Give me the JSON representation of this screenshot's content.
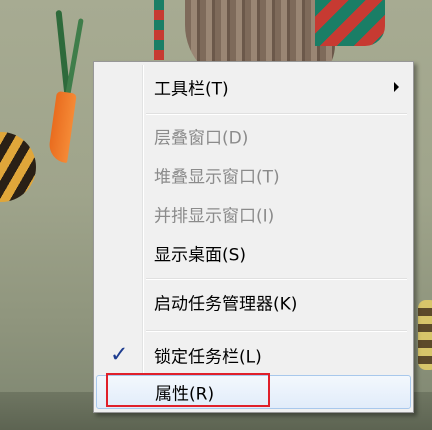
{
  "context_menu": {
    "items": [
      {
        "label": "工具栏(T)",
        "state": "enabled",
        "submenu": true
      },
      {
        "label": "层叠窗口(D)",
        "state": "disabled"
      },
      {
        "label": "堆叠显示窗口(T)",
        "state": "disabled"
      },
      {
        "label": "并排显示窗口(I)",
        "state": "disabled"
      },
      {
        "label": "显示桌面(S)",
        "state": "enabled"
      },
      {
        "label": "启动任务管理器(K)",
        "state": "enabled"
      },
      {
        "label": "锁定任务栏(L)",
        "state": "enabled",
        "checked": true
      },
      {
        "label": "属性(R)",
        "state": "hover"
      }
    ],
    "check_glyph": "✓"
  },
  "annotation": {
    "color": "#e0202a",
    "target": "属性(R)"
  },
  "colors": {
    "menu_bg": "#f0f0f0",
    "disabled_text": "#8b8b8b",
    "hover_border": "#a8c8ec",
    "check": "#1d3c8f"
  }
}
